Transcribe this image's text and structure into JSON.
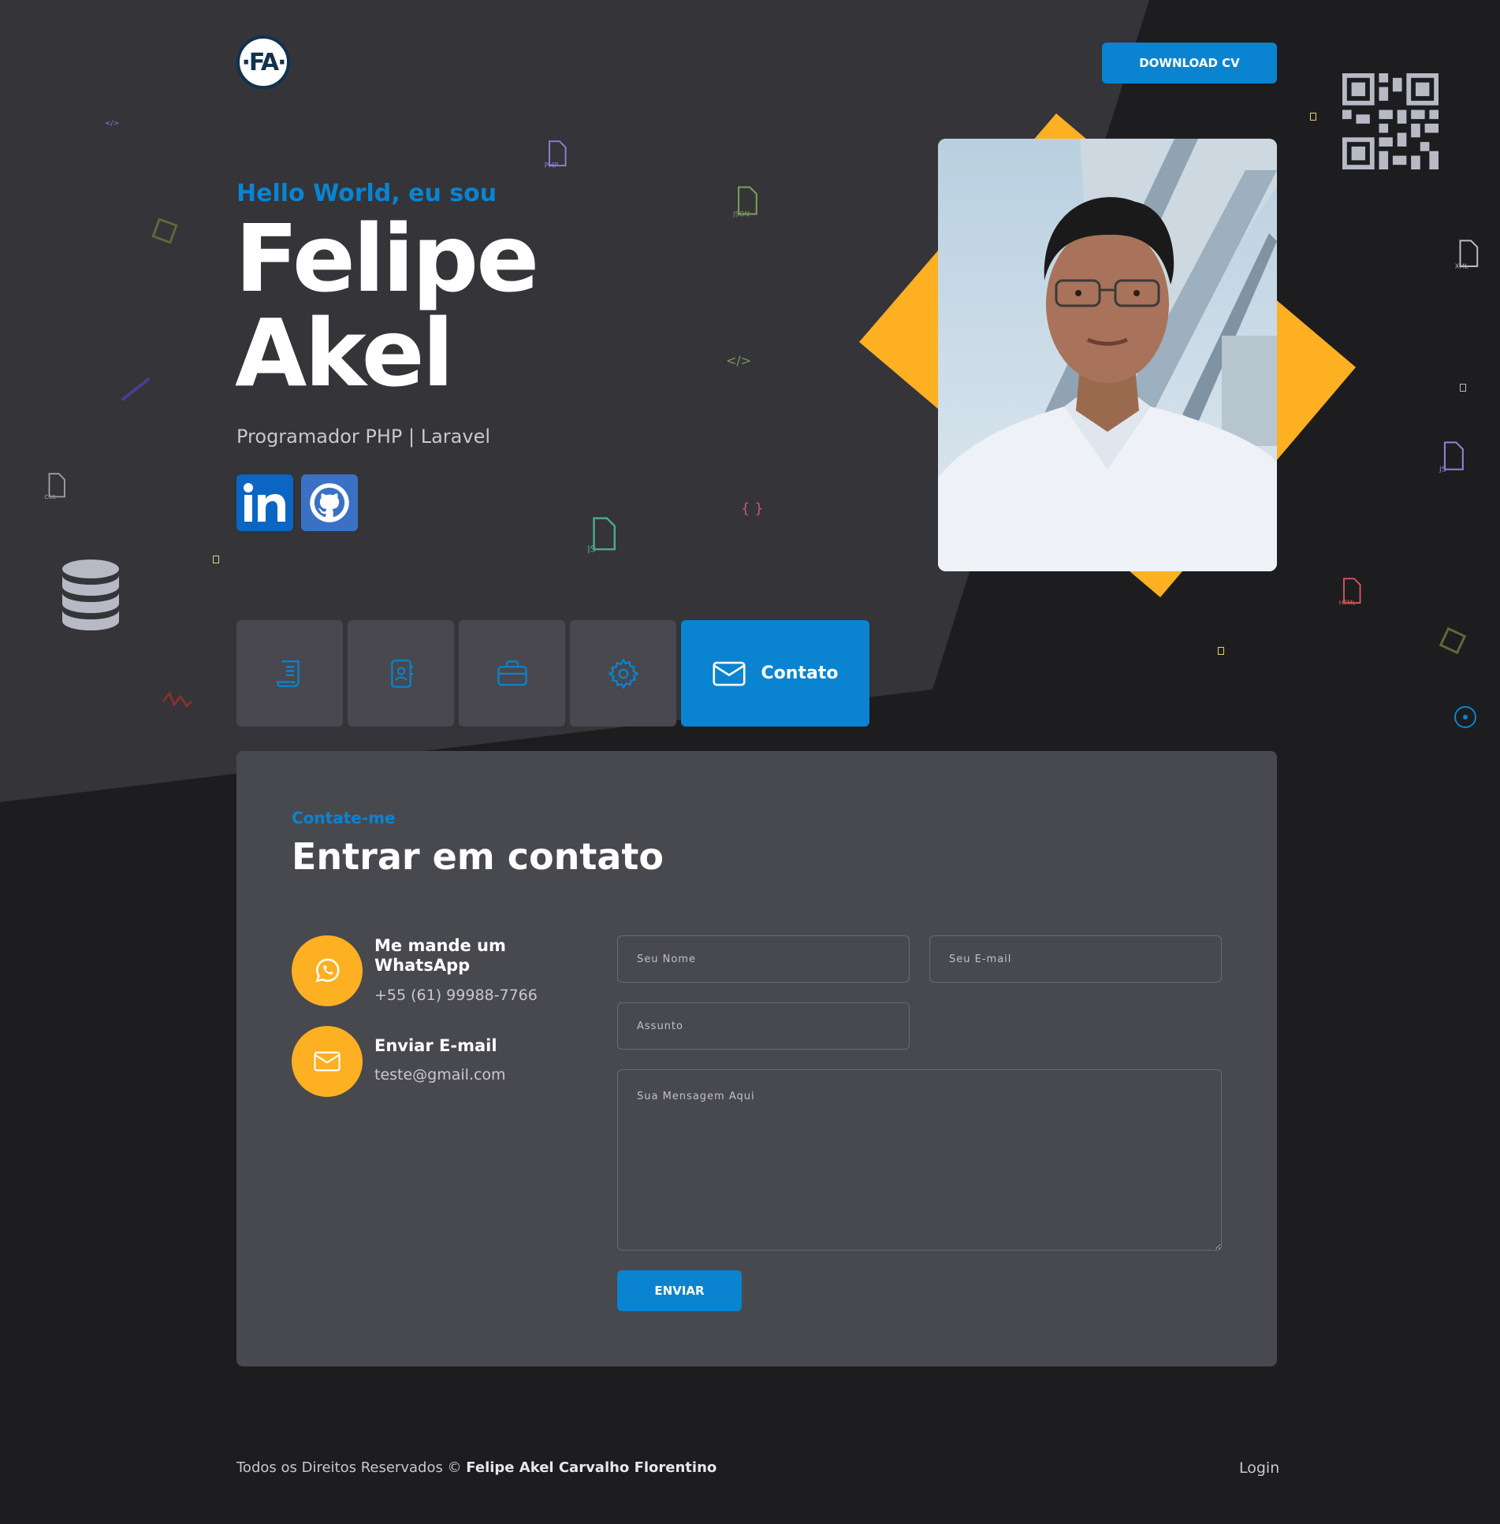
{
  "header": {
    "logo_text": "·FA·",
    "download_label": "DOWNLOAD CV"
  },
  "hero": {
    "greeting": "Hello World, eu sou",
    "first_name": "Felipe",
    "last_name": "Akel",
    "role": "Programador PHP | Laravel"
  },
  "social": [
    {
      "name": "linkedin-icon"
    },
    {
      "name": "github-icon"
    }
  ],
  "tabs": [
    {
      "icon": "resume-icon"
    },
    {
      "icon": "contact-card-icon"
    },
    {
      "icon": "briefcase-icon"
    },
    {
      "icon": "gear-icon"
    },
    {
      "icon": "envelope-icon",
      "label": "Contato",
      "active": true
    }
  ],
  "contact": {
    "kicker": "Contate-me",
    "title": "Entrar em contato",
    "whatsapp": {
      "title_line1": "Me mande um",
      "title_line2": "WhatsApp",
      "value": "+55 (61) 99988-7766"
    },
    "email": {
      "title": "Enviar E-mail",
      "value": "teste@gmail.com"
    },
    "form": {
      "name_placeholder": "Seu Nome",
      "email_placeholder": "Seu E-mail",
      "subject_placeholder": "Assunto",
      "message_placeholder": "Sua Mensagem Aqui",
      "submit_label": "ENVIAR"
    }
  },
  "deco_labels": {
    "php": "PHP",
    "json": "JSON",
    "css": "CSS",
    "js": "JS",
    "xml": "XML",
    "html": "HTML",
    "tag": "</>",
    "braces": "{ }"
  },
  "footer": {
    "rights": "Todos os Direitos Reservados ©",
    "owner": "Felipe Akel Carvalho Florentino",
    "login": "Login"
  },
  "colors": {
    "accent": "#0a84d0",
    "yellow": "#fdb022",
    "bg_dark": "#1d1c1f",
    "bg_panel": "#343439",
    "card": "#48494f"
  }
}
